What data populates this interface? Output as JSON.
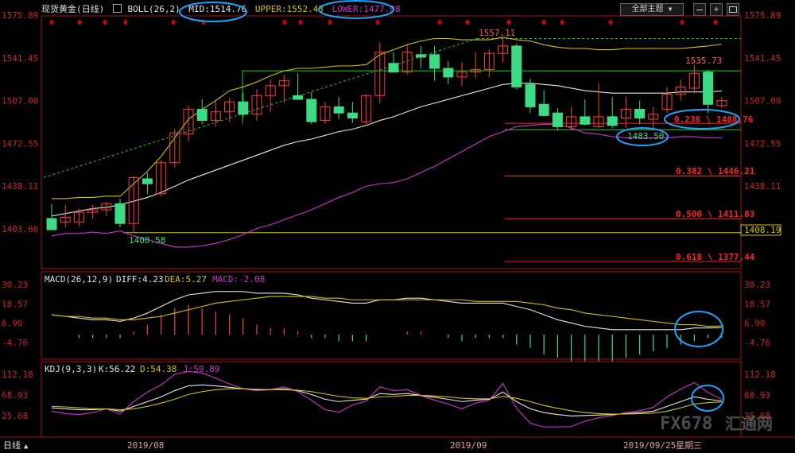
{
  "header": {
    "title": "现货黄金(日线)",
    "boll_label": "BOLL(26,2)",
    "mid_label": "MID:1514.76",
    "upper_label": "UPPER:1552.43",
    "lower_label": "LOWER:1477.08",
    "theme_select": "全部主题",
    "theme_arrow": "▼"
  },
  "colors": {
    "bg": "#000000",
    "up": "#ff3b3b",
    "down": "#3ddc84",
    "mid": "#e6e6e6",
    "upper": "#d4c400",
    "lower": "#cc33cc",
    "axis": "#cc2222",
    "fib": "#ff2222",
    "green_line": "#22cc22",
    "yellow_line": "#d4c400",
    "highlight_circle": "#1aa3ff"
  },
  "price_axis_ticks": [
    "1575.89",
    "1541.45",
    "1507.00",
    "1472.55",
    "1438.11",
    "1403.66"
  ],
  "right_axis_current": "1408.19",
  "annotations": {
    "high": "1557.11",
    "recent_high": "1535.73",
    "low_start": "1400.58",
    "recent_low": "1483.50",
    "fib_0236": "0.236 \\ 1488.76",
    "fib_0382": "0.382 \\ 1446.21",
    "fib_0500": "0.500 \\ 1411.83",
    "fib_0618": "0.618 \\ 1377.44"
  },
  "macd": {
    "title": "MACD(26,12,9)",
    "diff": "DIFF:4.23",
    "dea": "DEA:5.27",
    "macd": "MACD:-2.08",
    "ticks": [
      "30.23",
      "18.57",
      "6.90",
      "-4.76"
    ]
  },
  "kdj": {
    "title": "KDJ(9,3,3)",
    "k": "K:56.22",
    "d": "D:54.38",
    "j": "J:59.89",
    "ticks": [
      "112.18",
      "68.93",
      "25.68"
    ]
  },
  "bottom": {
    "period": "日线",
    "period_arrow": "▲",
    "date1": "2019/08",
    "date2": "2019/09",
    "last_date": "2019/09/25",
    "weekday": "星期三",
    "watermark": "FX678",
    "watermark_cn": "汇通网"
  },
  "chart_data": {
    "type": "candlestick",
    "instrument": "现货黄金",
    "period": "日线",
    "ylim": [
      1393,
      1585
    ],
    "candles": [
      {
        "o": 1412,
        "h": 1424,
        "l": 1408,
        "c": 1403
      },
      {
        "o": 1409,
        "h": 1423,
        "l": 1405,
        "c": 1413
      },
      {
        "o": 1409,
        "h": 1420,
        "l": 1406,
        "c": 1417
      },
      {
        "o": 1417,
        "h": 1423,
        "l": 1412,
        "c": 1419
      },
      {
        "o": 1419,
        "h": 1425,
        "l": 1414,
        "c": 1424
      },
      {
        "o": 1424,
        "h": 1428,
        "l": 1405,
        "c": 1408
      },
      {
        "o": 1408,
        "h": 1446,
        "l": 1400.58,
        "c": 1445
      },
      {
        "o": 1444,
        "h": 1449,
        "l": 1432,
        "c": 1440
      },
      {
        "o": 1432,
        "h": 1459,
        "l": 1430,
        "c": 1457
      },
      {
        "o": 1457,
        "h": 1484,
        "l": 1453,
        "c": 1481
      },
      {
        "o": 1480,
        "h": 1503,
        "l": 1474,
        "c": 1500
      },
      {
        "o": 1500,
        "h": 1508,
        "l": 1488,
        "c": 1491
      },
      {
        "o": 1491,
        "h": 1508,
        "l": 1486,
        "c": 1498
      },
      {
        "o": 1498,
        "h": 1509,
        "l": 1490,
        "c": 1506
      },
      {
        "o": 1506,
        "h": 1513,
        "l": 1494,
        "c": 1496
      },
      {
        "o": 1496,
        "h": 1516,
        "l": 1491,
        "c": 1511
      },
      {
        "o": 1511,
        "h": 1524,
        "l": 1498,
        "c": 1519
      },
      {
        "o": 1519,
        "h": 1528,
        "l": 1505,
        "c": 1523
      },
      {
        "o": 1511,
        "h": 1529,
        "l": 1510,
        "c": 1508
      },
      {
        "o": 1508,
        "h": 1514,
        "l": 1488,
        "c": 1490
      },
      {
        "o": 1491,
        "h": 1506,
        "l": 1488,
        "c": 1502
      },
      {
        "o": 1502,
        "h": 1510,
        "l": 1492,
        "c": 1497
      },
      {
        "o": 1497,
        "h": 1506,
        "l": 1489,
        "c": 1493
      },
      {
        "o": 1490,
        "h": 1512,
        "l": 1488,
        "c": 1511
      },
      {
        "o": 1511,
        "h": 1554,
        "l": 1505,
        "c": 1546
      },
      {
        "o": 1537,
        "h": 1546,
        "l": 1530,
        "c": 1530
      },
      {
        "o": 1530,
        "h": 1552,
        "l": 1528,
        "c": 1546
      },
      {
        "o": 1544,
        "h": 1551,
        "l": 1533,
        "c": 1542
      },
      {
        "o": 1544,
        "h": 1551,
        "l": 1523,
        "c": 1533
      },
      {
        "o": 1533,
        "h": 1539,
        "l": 1520,
        "c": 1526
      },
      {
        "o": 1526,
        "h": 1538,
        "l": 1519,
        "c": 1530
      },
      {
        "o": 1530,
        "h": 1546,
        "l": 1525,
        "c": 1532
      },
      {
        "o": 1532,
        "h": 1548,
        "l": 1526,
        "c": 1545
      },
      {
        "o": 1545,
        "h": 1557.11,
        "l": 1538,
        "c": 1551
      },
      {
        "o": 1551,
        "h": 1553,
        "l": 1516,
        "c": 1518
      },
      {
        "o": 1520,
        "h": 1525,
        "l": 1497,
        "c": 1502
      },
      {
        "o": 1504,
        "h": 1515,
        "l": 1494,
        "c": 1495
      },
      {
        "o": 1497,
        "h": 1501,
        "l": 1483,
        "c": 1486
      },
      {
        "o": 1486,
        "h": 1502,
        "l": 1483,
        "c": 1494
      },
      {
        "o": 1494,
        "h": 1508,
        "l": 1487,
        "c": 1488
      },
      {
        "o": 1486,
        "h": 1521,
        "l": 1485,
        "c": 1494
      },
      {
        "o": 1494,
        "h": 1510,
        "l": 1485,
        "c": 1487
      },
      {
        "o": 1493,
        "h": 1510,
        "l": 1485,
        "c": 1500
      },
      {
        "o": 1500,
        "h": 1507,
        "l": 1488,
        "c": 1493
      },
      {
        "o": 1492,
        "h": 1502,
        "l": 1483.5,
        "c": 1496
      },
      {
        "o": 1500,
        "h": 1518,
        "l": 1497,
        "c": 1512
      },
      {
        "o": 1512,
        "h": 1524,
        "l": 1507,
        "c": 1518
      },
      {
        "o": 1517,
        "h": 1535.73,
        "l": 1513,
        "c": 1529
      },
      {
        "o": 1530,
        "h": 1532,
        "l": 1497,
        "c": 1504
      },
      {
        "o": 1503,
        "h": 1510,
        "l": 1501,
        "c": 1507
      }
    ],
    "mid": [
      1414,
      1416,
      1418,
      1420,
      1421,
      1423,
      1426,
      1429,
      1433,
      1438,
      1443,
      1447,
      1451,
      1455,
      1459,
      1463,
      1467,
      1471,
      1474,
      1476,
      1479,
      1482,
      1484,
      1487,
      1491,
      1494,
      1498,
      1502,
      1505,
      1508,
      1511,
      1514,
      1517,
      1520,
      1521,
      1521,
      1520,
      1519,
      1517,
      1515,
      1514,
      1513,
      1513,
      1513,
      1513,
      1513,
      1514,
      1514,
      1514,
      1514.76
    ],
    "upper": [
      1428,
      1428,
      1429,
      1429,
      1430,
      1430,
      1440,
      1450,
      1462,
      1477,
      1492,
      1500,
      1507,
      1515,
      1518,
      1522,
      1527,
      1531,
      1533,
      1533,
      1534,
      1535,
      1535,
      1536,
      1544,
      1548,
      1552,
      1555,
      1557,
      1557,
      1556,
      1556,
      1556,
      1558,
      1556,
      1555,
      1552,
      1550,
      1549,
      1549,
      1548,
      1548,
      1549,
      1549,
      1549,
      1549,
      1549,
      1550,
      1551,
      1552.43
    ],
    "lower": [
      1398,
      1400,
      1400,
      1401,
      1400,
      1402,
      1398,
      1395,
      1392,
      1389,
      1389,
      1390,
      1392,
      1395,
      1399,
      1404,
      1407,
      1411,
      1415,
      1419,
      1424,
      1429,
      1433,
      1438,
      1440,
      1441,
      1444,
      1449,
      1454,
      1460,
      1466,
      1472,
      1478,
      1482,
      1486,
      1487,
      1488,
      1488,
      1485,
      1481,
      1480,
      1478,
      1477,
      1477,
      1477,
      1477,
      1478,
      1478,
      1477,
      1477.08
    ],
    "macd_diff": [
      12,
      11,
      10,
      9,
      9,
      8,
      10,
      13,
      17,
      21,
      24,
      25,
      26,
      26,
      26,
      25,
      25,
      25,
      24,
      22,
      21,
      20,
      19,
      19,
      21,
      21,
      22,
      22,
      21,
      20,
      19,
      19,
      19,
      19,
      17,
      15,
      12,
      9,
      7,
      5,
      4,
      3,
      3,
      3,
      3,
      3,
      3,
      4,
      4,
      4.23
    ],
    "macd_dea": [
      12,
      11,
      11,
      10,
      10,
      9,
      9,
      10,
      11,
      13,
      15,
      17,
      19,
      20,
      21,
      22,
      23,
      23,
      23,
      23,
      22,
      22,
      21,
      21,
      21,
      21,
      21,
      21,
      21,
      21,
      21,
      20,
      20,
      20,
      20,
      19,
      18,
      16,
      15,
      13,
      12,
      11,
      10,
      9,
      8,
      7,
      6,
      6,
      5,
      5.27
    ],
    "kdj_k": [
      42,
      40,
      38,
      38,
      40,
      35,
      45,
      55,
      65,
      78,
      88,
      90,
      88,
      85,
      82,
      80,
      80,
      82,
      78,
      70,
      60,
      55,
      58,
      60,
      72,
      70,
      72,
      68,
      64,
      60,
      55,
      58,
      60,
      75,
      55,
      40,
      32,
      28,
      25,
      26,
      27,
      28,
      30,
      32,
      35,
      45,
      55,
      65,
      60,
      56.22
    ],
    "kdj_d": [
      45,
      44,
      42,
      40,
      40,
      38,
      40,
      45,
      52,
      60,
      70,
      76,
      80,
      82,
      82,
      81,
      80,
      80,
      79,
      76,
      71,
      66,
      63,
      62,
      65,
      66,
      68,
      68,
      67,
      65,
      62,
      61,
      61,
      66,
      62,
      55,
      47,
      41,
      36,
      32,
      30,
      29,
      29,
      30,
      31,
      35,
      42,
      50,
      53,
      54.38
    ],
    "kdj_j": [
      35,
      30,
      28,
      32,
      40,
      29,
      55,
      75,
      90,
      112,
      118,
      115,
      104,
      92,
      82,
      78,
      80,
      86,
      76,
      58,
      38,
      33,
      48,
      56,
      86,
      78,
      80,
      68,
      58,
      50,
      40,
      52,
      58,
      93,
      41,
      10,
      2,
      2,
      3,
      14,
      21,
      26,
      32,
      36,
      43,
      65,
      81,
      95,
      74,
      59.89
    ]
  }
}
